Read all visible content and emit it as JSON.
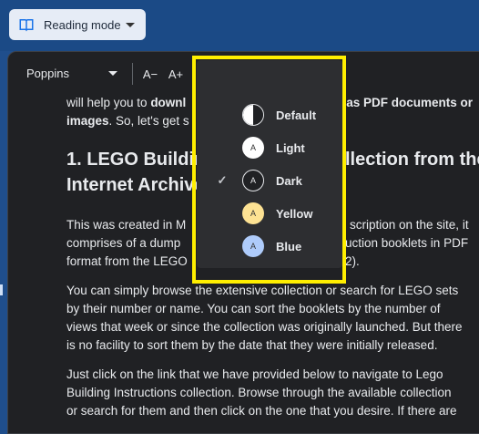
{
  "topbar": {
    "mode_button_label": "Reading mode"
  },
  "toolbar": {
    "font": "Poppins",
    "decrease_label": "A−",
    "increase_label": "A+"
  },
  "article": {
    "intro_parts": [
      "will help you to ",
      "downl",
      "s as PDF documents or",
      "images",
      ". So, let's get s"
    ],
    "heading_line1_left": "1. LEGO Building",
    "heading_line1_right": "llection from the",
    "heading_line2": "Internet Archive",
    "para1_lines": [
      [
        "This was created in M",
        "scription on the site, it"
      ],
      [
        "comprises of a dump",
        "uction booklets in PDF"
      ],
      [
        "format from the LEGO",
        "2)."
      ]
    ],
    "para2_lines": [
      "You can simply browse the extensive collection or search for LEGO sets",
      "by their number or name. You can sort the booklets by the number of",
      "views that week or since the collection was originally launched. But there",
      "is no facility to sort them by the date that they were initially released."
    ],
    "para3_lines": [
      "Just click on the link that we have provided below to navigate to Lego",
      "Building Instructions collection. Browse through the available collection",
      "or search for them and then click on the one that you desire. If there are"
    ]
  },
  "theme_menu": {
    "options": [
      {
        "label": "Default",
        "swatch": "half",
        "selected": false
      },
      {
        "label": "Light",
        "swatch_letter": "A",
        "bg": "#ffffff",
        "fg": "#333333",
        "selected": false
      },
      {
        "label": "Dark",
        "swatch_letter": "A",
        "bg": "#202124",
        "fg": "#e8eaed",
        "selected": true
      },
      {
        "label": "Yellow",
        "swatch_letter": "A",
        "bg": "#fde293",
        "fg": "#333333",
        "selected": false
      },
      {
        "label": "Blue",
        "swatch_letter": "A",
        "bg": "#aecbfa",
        "fg": "#333333",
        "selected": false
      }
    ],
    "check_glyph": "✓"
  },
  "colors": {
    "highlight": "#ffee00",
    "panel_bg": "#202124",
    "page_bg": "#1f4e8c"
  }
}
